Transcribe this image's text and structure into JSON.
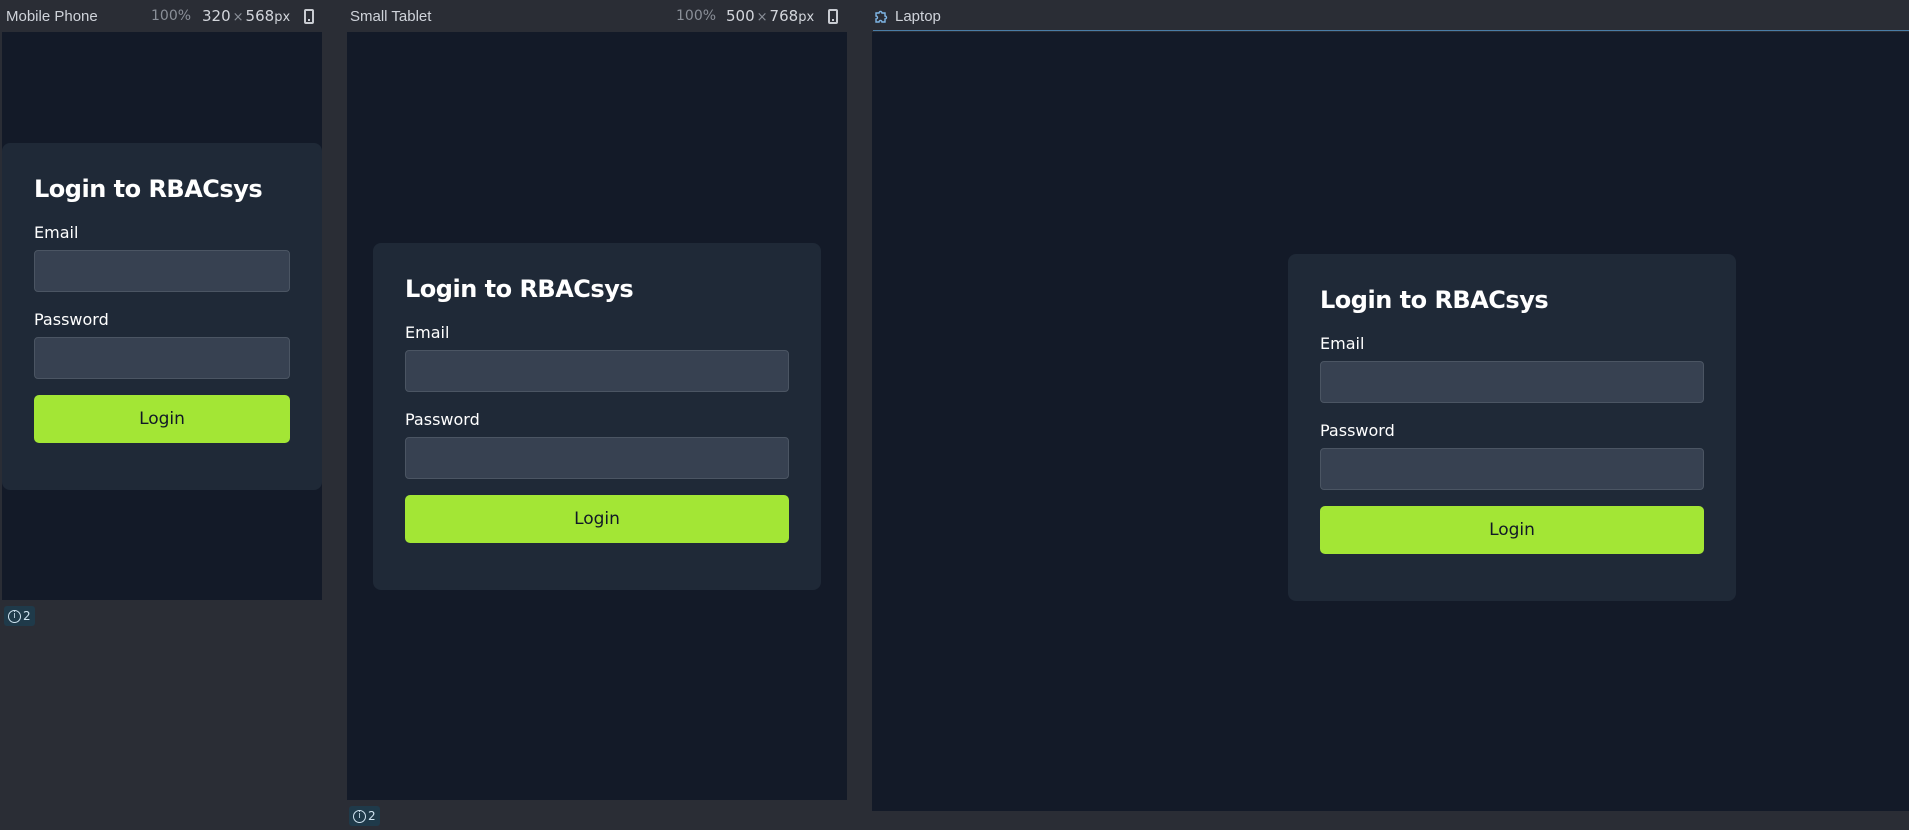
{
  "panes": {
    "mobile": {
      "name": "Mobile Phone",
      "zoom": "100%",
      "width": "320",
      "height": "568",
      "unit": "px",
      "badge_count": "2"
    },
    "tablet": {
      "name": "Small Tablet",
      "zoom": "100%",
      "width": "500",
      "height": "768",
      "unit": "px",
      "badge_count": "2"
    },
    "laptop": {
      "name": "Laptop"
    }
  },
  "login": {
    "title": "Login to RBACsys",
    "email_label": "Email",
    "password_label": "Password",
    "button_label": "Login"
  },
  "icons": {
    "device": "phone-device-icon",
    "laptop": "puzzle-icon",
    "info": "info-icon"
  },
  "colors": {
    "background": "#131a28",
    "card": "#1f2937",
    "input": "#374151",
    "accent": "#a3e635"
  }
}
